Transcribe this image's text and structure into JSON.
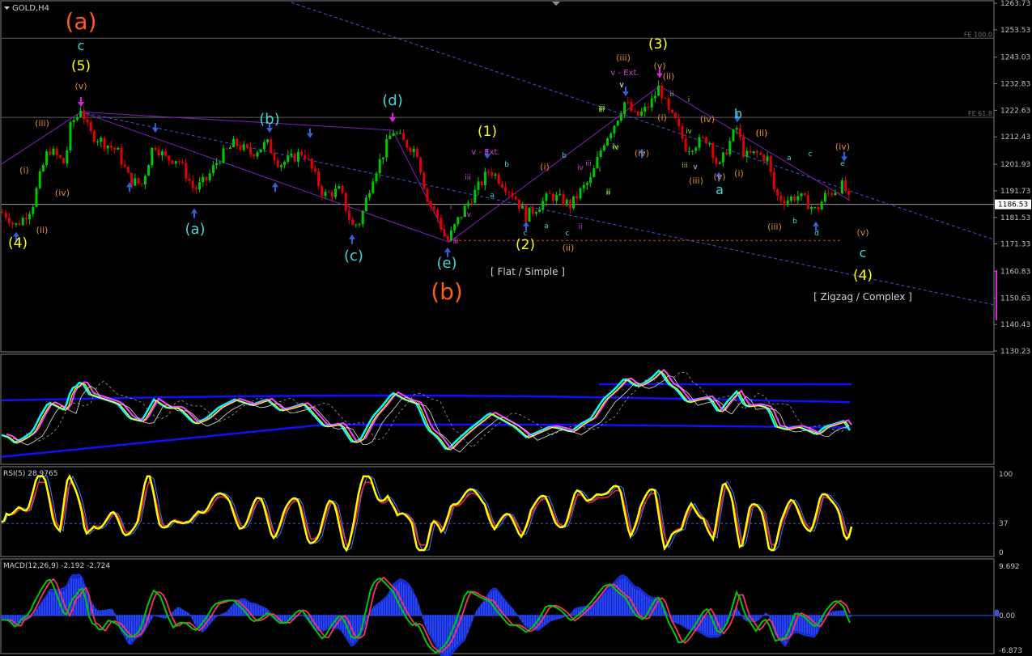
{
  "chart_data": [
    {
      "type": "candlestick",
      "title": "GOLD,H4",
      "symbol": "GOLD",
      "timeframe": "H4",
      "ylim": [
        1130.23,
        1263.73
      ],
      "y_ticks": [
        "1263.73",
        "1253.53",
        "1243.03",
        "1232.83",
        "1222.63",
        "1212.43",
        "1201.93",
        "1191.73",
        "1181.53",
        "1171.33",
        "1160.83",
        "1150.63",
        "1140.43",
        "1130.23"
      ],
      "current_price": "1186.53",
      "fib_levels": [
        {
          "label": "FE 100.0",
          "price": 1250.3
        },
        {
          "label": "FE 61.8",
          "price": 1219.9
        }
      ],
      "support_line_price": 1172.7,
      "price_path_anchors": [
        [
          0,
          1184
        ],
        [
          10,
          1182
        ],
        [
          18,
          1178
        ],
        [
          28,
          1181
        ],
        [
          40,
          1186
        ],
        [
          50,
          1198
        ],
        [
          60,
          1208
        ],
        [
          70,
          1205
        ],
        [
          80,
          1202
        ],
        [
          88,
          1218
        ],
        [
          95,
          1220
        ],
        [
          100,
          1224
        ],
        [
          110,
          1214
        ],
        [
          120,
          1212
        ],
        [
          130,
          1210
        ],
        [
          145,
          1207
        ],
        [
          160,
          1196
        ],
        [
          175,
          1194
        ],
        [
          190,
          1210
        ],
        [
          205,
          1204
        ],
        [
          220,
          1204
        ],
        [
          240,
          1192
        ],
        [
          255,
          1196
        ],
        [
          270,
          1204
        ],
        [
          290,
          1210
        ],
        [
          310,
          1206
        ],
        [
          330,
          1210
        ],
        [
          345,
          1202
        ],
        [
          360,
          1204
        ],
        [
          375,
          1207
        ],
        [
          385,
          1200
        ],
        [
          400,
          1190
        ],
        [
          420,
          1192
        ],
        [
          435,
          1178
        ],
        [
          445,
          1180
        ],
        [
          460,
          1197
        ],
        [
          472,
          1205
        ],
        [
          485,
          1215
        ],
        [
          500,
          1210
        ],
        [
          515,
          1207
        ],
        [
          528,
          1188
        ],
        [
          540,
          1182
        ],
        [
          552,
          1172
        ],
        [
          565,
          1180
        ],
        [
          580,
          1188
        ],
        [
          595,
          1195
        ],
        [
          605,
          1200
        ],
        [
          620,
          1195
        ],
        [
          635,
          1190
        ],
        [
          650,
          1182
        ],
        [
          665,
          1186
        ],
        [
          680,
          1190
        ],
        [
          695,
          1188
        ],
        [
          705,
          1186
        ],
        [
          718,
          1192
        ],
        [
          730,
          1196
        ],
        [
          745,
          1210
        ],
        [
          760,
          1218
        ],
        [
          772,
          1226
        ],
        [
          785,
          1220
        ],
        [
          795,
          1222
        ],
        [
          805,
          1226
        ],
        [
          815,
          1232
        ],
        [
          825,
          1222
        ],
        [
          835,
          1218
        ],
        [
          848,
          1208
        ],
        [
          860,
          1210
        ],
        [
          875,
          1212
        ],
        [
          888,
          1200
        ],
        [
          898,
          1208
        ],
        [
          910,
          1216
        ],
        [
          920,
          1205
        ],
        [
          935,
          1206
        ],
        [
          948,
          1204
        ],
        [
          958,
          1190
        ],
        [
          970,
          1188
        ],
        [
          985,
          1190
        ],
        [
          998,
          1187
        ],
        [
          1008,
          1184
        ],
        [
          1020,
          1190
        ],
        [
          1032,
          1192
        ],
        [
          1042,
          1194
        ],
        [
          1050,
          1187
        ]
      ],
      "wave_labels": [
        {
          "text": "(a)",
          "color": "#ff5a1e",
          "size": 28
        },
        {
          "text": "c",
          "color": "#40d6d6",
          "size": 16
        },
        {
          "text": "(5)",
          "color": "#ffff00",
          "size": 17
        },
        {
          "text": "(v)",
          "color": "#e08a2e",
          "size": 11
        },
        {
          "text": "(iii)",
          "color": "#e08a2e",
          "size": 11
        },
        {
          "text": "(i)",
          "color": "#e08a2e",
          "size": 11
        },
        {
          "text": "(iv)",
          "color": "#e08a2e",
          "size": 11
        },
        {
          "text": "(ii)",
          "color": "#e08a2e",
          "size": 11
        },
        {
          "text": "(4)",
          "color": "#ffff00",
          "size": 17
        },
        {
          "text": "(b)",
          "color": "#40d6d6",
          "size": 18
        },
        {
          "text": "(a)",
          "color": "#40d6d6",
          "size": 18
        },
        {
          "text": "(c)",
          "color": "#40d6d6",
          "size": 18
        },
        {
          "text": "(d)",
          "color": "#40d6d6",
          "size": 18
        },
        {
          "text": "(e)",
          "color": "#40d6d6",
          "size": 18
        },
        {
          "text": "(b)",
          "color": "#ff5a1e",
          "size": 28
        },
        {
          "text": "(1)",
          "color": "#ffff00",
          "size": 17
        },
        {
          "text": "v - Ext.",
          "color": "#d040d0",
          "size": 10
        },
        {
          "text": "(2)",
          "color": "#ffff00",
          "size": 17
        },
        {
          "text": "[ Flat / Simple ]",
          "color": "#d0d0d0",
          "size": 12
        },
        {
          "text": "(3)",
          "color": "#ffff00",
          "size": 17
        },
        {
          "text": "(iii)",
          "color": "#e08a2e",
          "size": 11
        },
        {
          "text": "v - Ext.",
          "color": "#d040d0",
          "size": 10
        },
        {
          "text": "(v)",
          "color": "#e08a2e",
          "size": 11
        },
        {
          "text": "(ii)",
          "color": "#e08a2e",
          "size": 11
        },
        {
          "text": "(i)",
          "color": "#e08a2e",
          "size": 11
        },
        {
          "text": "(iv)",
          "color": "#e08a2e",
          "size": 11
        },
        {
          "text": "(iv)",
          "color": "#e08a2e",
          "size": 11
        },
        {
          "text": "(iii)",
          "color": "#e08a2e",
          "size": 11
        },
        {
          "text": "(v)",
          "color": "#e08a2e",
          "size": 11
        },
        {
          "text": "a",
          "color": "#40d6d6",
          "size": 16
        },
        {
          "text": "b",
          "color": "#40d6d6",
          "size": 16
        },
        {
          "text": "(ii)",
          "color": "#e08a2e",
          "size": 11
        },
        {
          "text": "(i)",
          "color": "#e08a2e",
          "size": 11
        },
        {
          "text": "(iii)",
          "color": "#e08a2e",
          "size": 11
        },
        {
          "text": "(iv)",
          "color": "#e08a2e",
          "size": 11
        },
        {
          "text": "(v)",
          "color": "#e08a2e",
          "size": 11
        },
        {
          "text": "c",
          "color": "#40d6d6",
          "size": 16
        },
        {
          "text": "(4)",
          "color": "#ffff00",
          "size": 17
        },
        {
          "text": "[ Zigzag / Complex ]",
          "color": "#d0d0d0",
          "size": 12
        },
        {
          "text": "(i)",
          "color": "#e08a2e",
          "size": 11
        },
        {
          "text": "(ii)",
          "color": "#e08a2e",
          "size": 11
        },
        {
          "text": "(ii)",
          "color": "#e08a2e",
          "size": 11
        }
      ],
      "small_labels": [
        {
          "text": "i",
          "color": "#d040d0"
        },
        {
          "text": "ii",
          "color": "#d040d0"
        },
        {
          "text": "iii",
          "color": "#d040d0"
        },
        {
          "text": "iv",
          "color": "#d040d0"
        },
        {
          "text": "a",
          "color": "#40d6d6"
        },
        {
          "text": "b",
          "color": "#40d6d6"
        },
        {
          "text": "c",
          "color": "#40d6d6"
        },
        {
          "text": "a",
          "color": "#40d6d6"
        },
        {
          "text": "b",
          "color": "#40d6d6"
        },
        {
          "text": "c",
          "color": "#40d6d6"
        },
        {
          "text": "iii",
          "color": "#d040d0"
        },
        {
          "text": "iv",
          "color": "#d040d0"
        },
        {
          "text": "ii",
          "color": "#d040d0"
        },
        {
          "text": "i",
          "color": "#7fd040"
        },
        {
          "text": "ii",
          "color": "#7fd040"
        },
        {
          "text": "iii",
          "color": "#7fd040"
        },
        {
          "text": "iv",
          "color": "#7fd040"
        },
        {
          "text": "v",
          "color": "#d0d0d0"
        },
        {
          "text": "i",
          "color": "#7fd040"
        },
        {
          "text": "ii",
          "color": "#7fd040"
        },
        {
          "text": "iii",
          "color": "#7fd040"
        },
        {
          "text": "iv",
          "color": "#7fd040"
        },
        {
          "text": "v",
          "color": "#d0d0d0"
        },
        {
          "text": "iii",
          "color": "#7fd040"
        },
        {
          "text": "iv",
          "color": "#7fd040"
        },
        {
          "text": "v",
          "color": "#d0d0d0"
        },
        {
          "text": "i",
          "color": "#7fd040"
        },
        {
          "text": "ii",
          "color": "#7fd040"
        },
        {
          "text": "a",
          "color": "#40d6d6"
        },
        {
          "text": "b",
          "color": "#40d6d6"
        },
        {
          "text": "c",
          "color": "#40d6d6"
        },
        {
          "text": "d",
          "color": "#40d6d6"
        },
        {
          "text": "e",
          "color": "#40d6d6"
        },
        {
          "text": "ii",
          "color": "#d040d0"
        }
      ],
      "colors": {
        "bull": "#00c800",
        "bear": "#e00000",
        "grid": "#808080",
        "text": "#c0c0c0"
      }
    },
    {
      "type": "line",
      "title": "",
      "description_ylim": [
        0,
        100
      ]
    },
    {
      "type": "line",
      "title": "RSI(5) 28.9765",
      "ylim": [
        0,
        100
      ],
      "y_ticks": [
        "100",
        "37",
        "0"
      ],
      "level": 37,
      "series": [
        {
          "name": "RSI(5)",
          "last": 28.9765,
          "color": "#ffff00"
        }
      ]
    },
    {
      "type": "line",
      "title": "MACD(12,26,9) -2.192 -2.724",
      "ylim": [
        -6.873,
        9.692
      ],
      "y_ticks": [
        "9.692",
        "0.00",
        "-6.873"
      ],
      "series": [
        {
          "name": "MACD",
          "last": -2.192,
          "color": "#00c800"
        },
        {
          "name": "Signal",
          "last": -2.724,
          "color": "#ff3060"
        }
      ]
    }
  ]
}
